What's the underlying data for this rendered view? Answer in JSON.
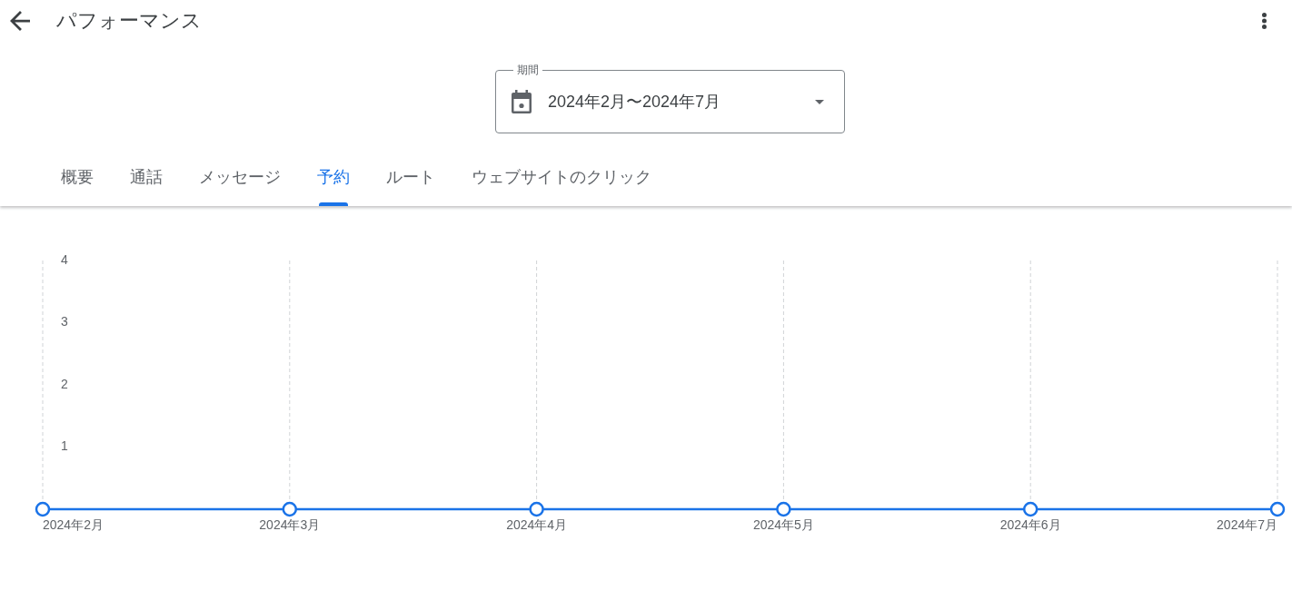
{
  "header": {
    "title": "パフォーマンス"
  },
  "date_range": {
    "label": "期間",
    "value": "2024年2月〜2024年7月"
  },
  "tabs": [
    {
      "label": "概要",
      "selected": false
    },
    {
      "label": "通話",
      "selected": false
    },
    {
      "label": "メッセージ",
      "selected": false
    },
    {
      "label": "予約",
      "selected": true
    },
    {
      "label": "ルート",
      "selected": false
    },
    {
      "label": "ウェブサイトのクリック",
      "selected": false
    }
  ],
  "chart": {
    "chart_data": {
      "type": "line",
      "categories": [
        "2024年2月",
        "2024年3月",
        "2024年4月",
        "2024年5月",
        "2024年6月",
        "2024年7月"
      ],
      "series": [
        {
          "color": "#1a73e8",
          "marker": "circle",
          "values": [
            0,
            0,
            0,
            0,
            0,
            0
          ]
        }
      ],
      "ylim": [
        0,
        4
      ],
      "yticks": [
        1,
        2,
        3,
        4
      ],
      "grid": true
    }
  }
}
